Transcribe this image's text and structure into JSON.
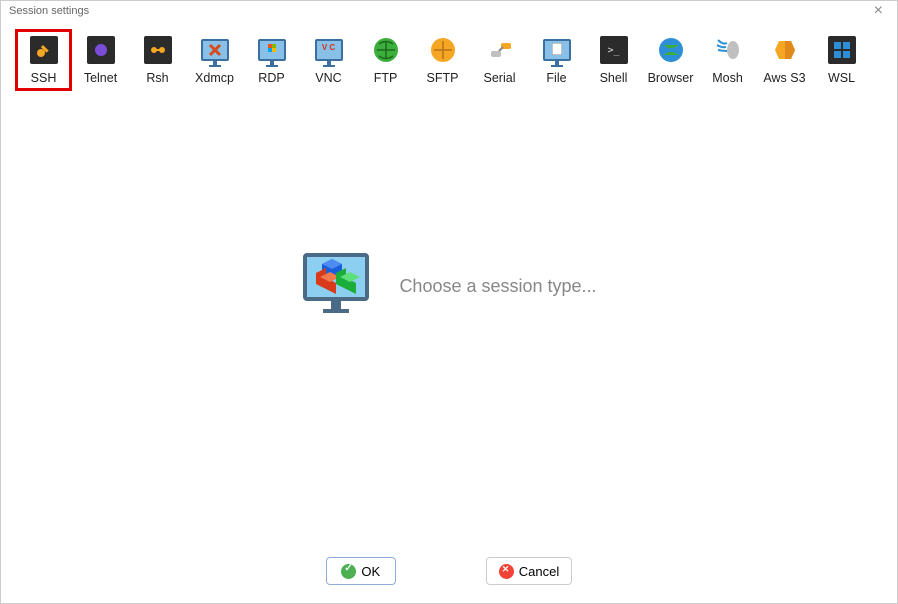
{
  "window": {
    "title": "Session settings"
  },
  "sessions": [
    {
      "id": "ssh",
      "label": "SSH",
      "highlighted": true
    },
    {
      "id": "telnet",
      "label": "Telnet",
      "highlighted": false
    },
    {
      "id": "rsh",
      "label": "Rsh",
      "highlighted": false
    },
    {
      "id": "xdmcp",
      "label": "Xdmcp",
      "highlighted": false
    },
    {
      "id": "rdp",
      "label": "RDP",
      "highlighted": false
    },
    {
      "id": "vnc",
      "label": "VNC",
      "highlighted": false
    },
    {
      "id": "ftp",
      "label": "FTP",
      "highlighted": false
    },
    {
      "id": "sftp",
      "label": "SFTP",
      "highlighted": false
    },
    {
      "id": "serial",
      "label": "Serial",
      "highlighted": false
    },
    {
      "id": "file",
      "label": "File",
      "highlighted": false
    },
    {
      "id": "shell",
      "label": "Shell",
      "highlighted": false
    },
    {
      "id": "browser",
      "label": "Browser",
      "highlighted": false
    },
    {
      "id": "mosh",
      "label": "Mosh",
      "highlighted": false
    },
    {
      "id": "awss3",
      "label": "Aws S3",
      "highlighted": false
    },
    {
      "id": "wsl",
      "label": "WSL",
      "highlighted": false
    }
  ],
  "main": {
    "prompt": "Choose a session type..."
  },
  "buttons": {
    "ok": "OK",
    "cancel": "Cancel"
  }
}
